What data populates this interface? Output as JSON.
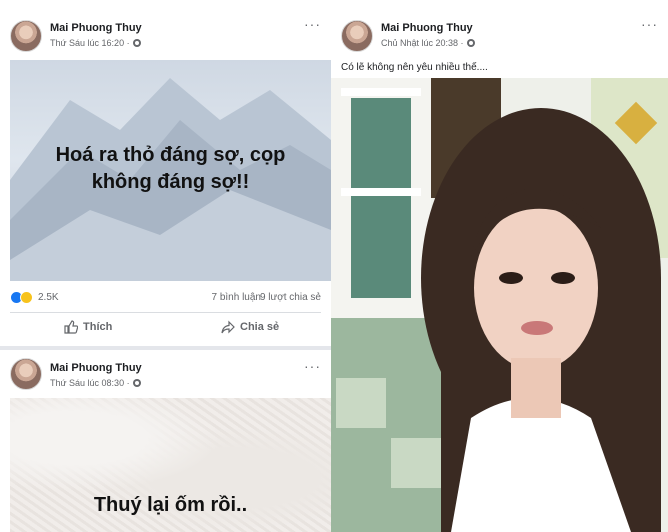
{
  "post1": {
    "author": "Mai Phuong Thuy",
    "time": "Thứ Sáu lúc 16:20 ·",
    "text": "Hoá ra thỏ đáng sợ, cọp\nkhông đáng sợ!!",
    "reactions": "2.5K",
    "comments": "7 bình luận",
    "shares": "9 lượt chia sẻ",
    "like_label": "Thích",
    "share_label": "Chia sẻ"
  },
  "post2": {
    "author": "Mai Phuong Thuy",
    "time": "Thứ Sáu lúc 08:30 ·",
    "text": "Thuý lại ốm rồi.."
  },
  "post3": {
    "author": "Mai Phuong Thuy",
    "time": "Chủ Nhật lúc 20:38 ·",
    "caption": "Có lẽ không nên yêu nhiều thế...."
  },
  "more_label": "···",
  "colors": {
    "facebook_blue": "#1877f2",
    "secondary_text": "#65676b"
  }
}
